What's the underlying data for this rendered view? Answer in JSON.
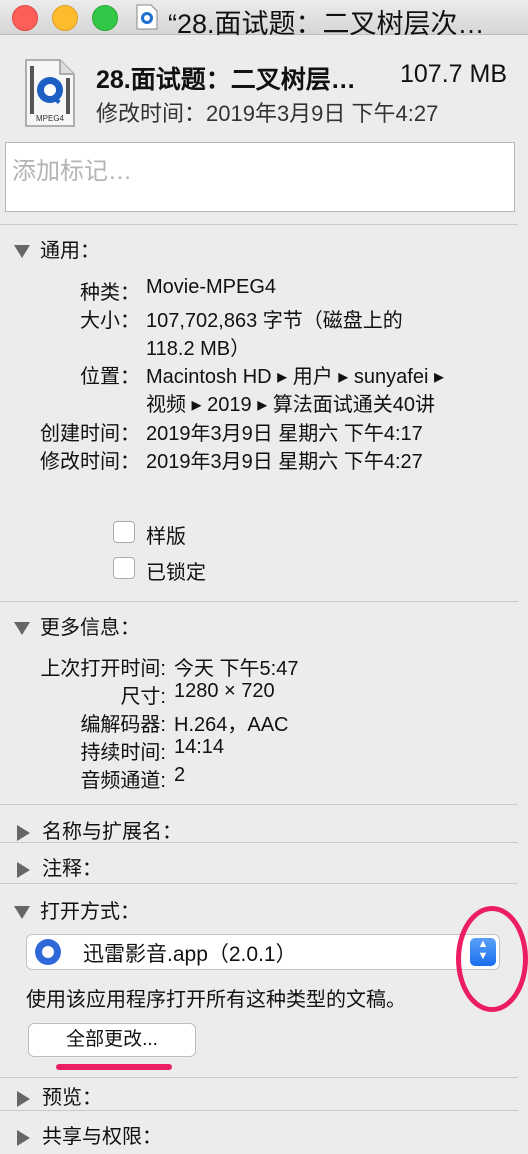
{
  "window": {
    "title": "“28.面试题：二叉树层次…"
  },
  "header": {
    "file_name": "28.面试题：二叉树层…",
    "file_size": "107.7 MB",
    "modified": "修改时间：2019年3月9日 下午4:27",
    "icon_label": "MPEG4"
  },
  "tags": {
    "placeholder": "添加标记…"
  },
  "general": {
    "heading": "通用：",
    "kind_label": "种类：",
    "kind_value": "Movie-MPEG4",
    "size_label": "大小：",
    "size_value_1": "107,702,863 字节（磁盘上的",
    "size_value_2": "118.2 MB）",
    "where_label": "位置：",
    "where_value_1": "Macintosh HD ▸ 用户 ▸ sunyafei ▸",
    "where_value_2": "视频 ▸ 2019 ▸ 算法面试通关40讲",
    "created_label": "创建时间：",
    "created_value": "2019年3月9日 星期六 下午4:17",
    "modified_label": "修改时间：",
    "modified_value": "2019年3月9日 星期六 下午4:27",
    "stationery_label": "样版",
    "locked_label": "已锁定"
  },
  "more_info": {
    "heading": "更多信息：",
    "rows": [
      {
        "label": "上次打开时间:",
        "value": "今天 下午5:47"
      },
      {
        "label": "尺寸:",
        "value": "1280 × 720"
      },
      {
        "label": "编解码器:",
        "value": "H.264，AAC"
      },
      {
        "label": "持续时间:",
        "value": "14:14"
      },
      {
        "label": "音频通道:",
        "value": "2"
      }
    ]
  },
  "name_ext": {
    "heading": "名称与扩展名："
  },
  "comments": {
    "heading": "注释："
  },
  "open_with": {
    "heading": "打开方式：",
    "app": "迅雷影音.app（2.0.1）",
    "description": "使用该应用程序打开所有这种类型的文稿。",
    "change_all": "全部更改..."
  },
  "preview": {
    "heading": "预览："
  },
  "sharing": {
    "heading": "共享与权限："
  },
  "colors": {
    "annotation": "#ec1e63"
  }
}
